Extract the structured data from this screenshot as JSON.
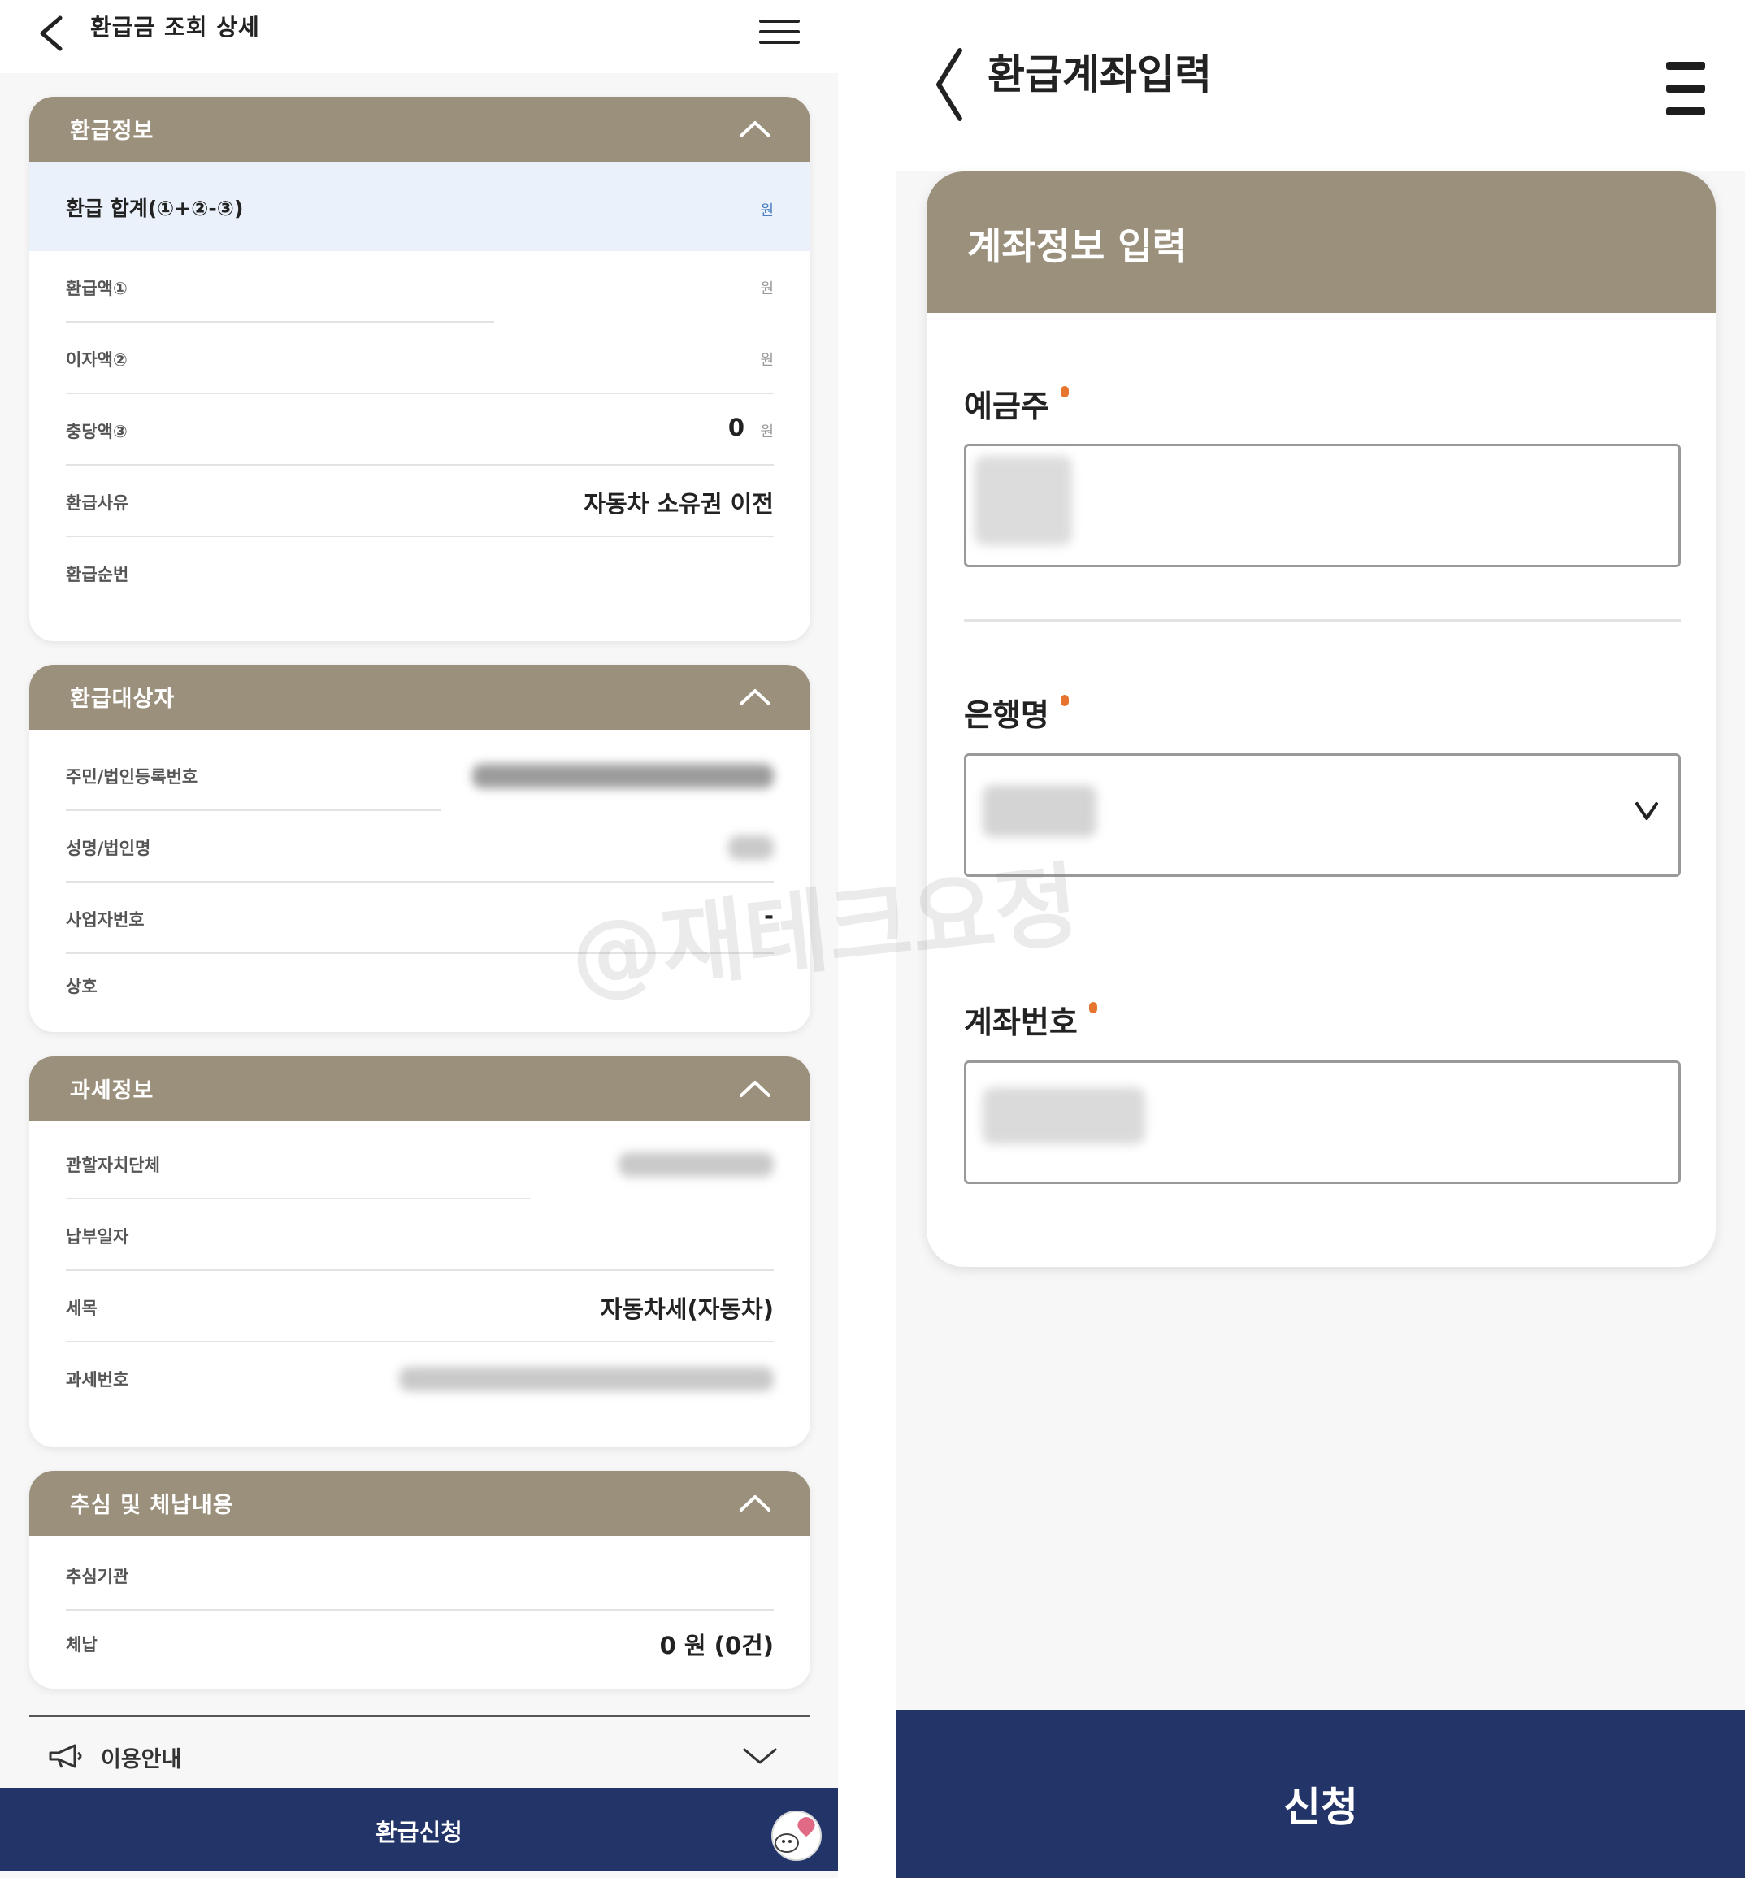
{
  "left": {
    "header": {
      "title": "환급금 조회 상세"
    },
    "refund_info": {
      "title": "환급정보",
      "total_label": "환급 합계(①+②-③)",
      "total_unit": "원",
      "rows": [
        {
          "label": "환급액①",
          "value": "",
          "unit": "원"
        },
        {
          "label": "이자액②",
          "value": "",
          "unit": "원"
        },
        {
          "label": "충당액③",
          "value": "0",
          "unit": "원"
        },
        {
          "label": "환급사유",
          "value": "자동차 소유권 이전",
          "unit": ""
        },
        {
          "label": "환급순번",
          "value": "",
          "unit": ""
        }
      ]
    },
    "refund_target": {
      "title": "환급대상자",
      "rows": [
        {
          "label": "주민/법인등록번호",
          "value": ""
        },
        {
          "label": "성명/법인명",
          "value": ""
        },
        {
          "label": "사업자번호",
          "value": "-"
        },
        {
          "label": "상호",
          "value": ""
        }
      ]
    },
    "tax_info": {
      "title": "과세정보",
      "rows": [
        {
          "label": "관할자치단체",
          "value": ""
        },
        {
          "label": "납부일자",
          "value": ""
        },
        {
          "label": "세목",
          "value": "자동차세(자동차)"
        },
        {
          "label": "과세번호",
          "value": ""
        }
      ]
    },
    "collection": {
      "title": "추심 및 체납내용",
      "rows": [
        {
          "label": "추심기관",
          "value": ""
        },
        {
          "label": "체납",
          "value": "0 원 (0건)"
        }
      ]
    },
    "guide": {
      "label": "이용안내"
    },
    "bottom_button": "환급신청"
  },
  "right": {
    "header": {
      "title": "환급계좌입력"
    },
    "panel_title": "계좌정보 입력",
    "fields": {
      "holder_label": "예금주",
      "bank_label": "은행명",
      "account_label": "계좌번호"
    },
    "bottom_button": "신청"
  },
  "watermark": "@재테크요정",
  "colors": {
    "section_header": "#9a907c",
    "primary_button": "#223468",
    "required_dot": "#e6742f"
  },
  "icons": {
    "back": "chevron-left-icon",
    "menu": "hamburger-menu-icon",
    "collapse": "chevron-up-icon",
    "dropdown": "chevron-down-icon",
    "guide": "megaphone-icon"
  }
}
